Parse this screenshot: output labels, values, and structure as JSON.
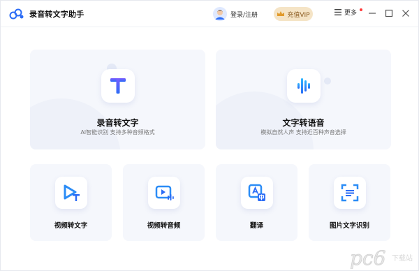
{
  "app": {
    "title": "录音转文字助手"
  },
  "header": {
    "login_label": "登录/注册",
    "vip_label": "充值VIP",
    "more_label": "更多"
  },
  "cards": {
    "audio_to_text": {
      "title": "录音转文字",
      "subtitle": "AI智能识别 支持多种音频格式"
    },
    "text_to_speech": {
      "title": "文字转语音",
      "subtitle": "模拟自然人声 支持近百种声音选择"
    },
    "video_to_text": {
      "title": "视频转文字"
    },
    "video_to_audio": {
      "title": "视频转音频"
    },
    "translate": {
      "title": "翻译"
    },
    "image_ocr": {
      "title": "图片文字识别"
    }
  },
  "watermark": {
    "text": "pc6",
    "sub": "下载站"
  },
  "colors": {
    "accent": "#2b6cf6",
    "vip_bg": "#f5e4c6",
    "card_bg": "#f5f7fc"
  }
}
